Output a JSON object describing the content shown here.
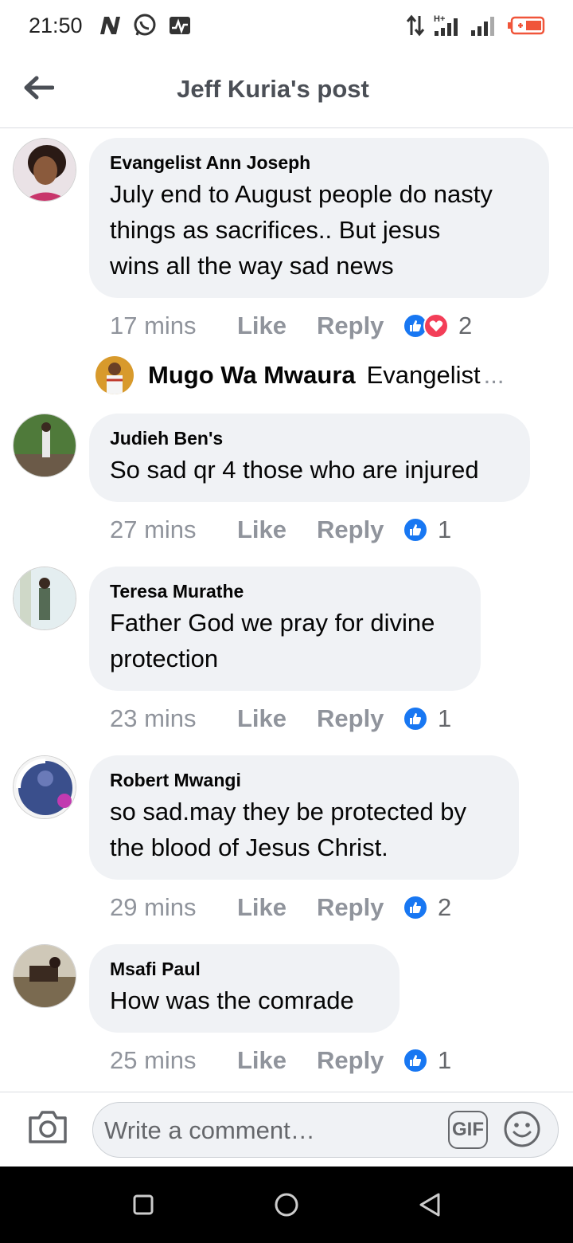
{
  "status_bar": {
    "time": "21:50",
    "icons": [
      "n-app-icon",
      "whatsapp-icon",
      "activity-icon",
      "data-arrows-icon",
      "signal-h-plus-icon",
      "signal-icon",
      "battery-icon"
    ]
  },
  "header": {
    "title": "Jeff Kuria's post",
    "back_icon": "back-arrow-icon"
  },
  "comments": [
    {
      "author": "Evangelist Ann Joseph",
      "text_lines": [
        "July end to August people do nasty",
        "things as sacrifices.. But jesus",
        "wins all the way sad news"
      ],
      "time": "17 mins",
      "like_label": "Like",
      "reply_label": "Reply",
      "reactions": [
        "like",
        "love"
      ],
      "reaction_count": "2"
    },
    {
      "author": "Judieh Ben's",
      "text_lines": [
        "So sad qr 4 those who are injured"
      ],
      "time": "27 mins",
      "like_label": "Like",
      "reply_label": "Reply",
      "reactions": [
        "like"
      ],
      "reaction_count": "1"
    },
    {
      "author": "Teresa Murathe",
      "text_lines": [
        "Father God we pray for divine",
        "protection"
      ],
      "time": "23 mins",
      "like_label": "Like",
      "reply_label": "Reply",
      "reactions": [
        "like"
      ],
      "reaction_count": "1"
    },
    {
      "author": "Robert Mwangi",
      "text_lines": [
        "so sad.may they be protected by",
        "the blood of Jesus Christ."
      ],
      "time": "29 mins",
      "like_label": "Like",
      "reply_label": "Reply",
      "reactions": [
        "like"
      ],
      "reaction_count": "2"
    },
    {
      "author": "Msafi Paul",
      "text_lines": [
        "How was the comrade"
      ],
      "time": "25 mins",
      "like_label": "Like",
      "reply_label": "Reply",
      "reactions": [
        "like"
      ],
      "reaction_count": "1"
    }
  ],
  "reply_preview": {
    "author": "Mugo Wa Mwaura",
    "snippet": "Evangelist",
    "ellipsis": "..."
  },
  "composer": {
    "placeholder": "Write a comment…",
    "gif_label": "GIF",
    "camera_icon": "camera-icon",
    "emoji_icon": "emoji-icon"
  },
  "colors": {
    "accent_blue": "#1877f2",
    "love_red": "#f33e58",
    "bubble_bg": "#f0f2f5",
    "meta_gray": "#90949c"
  }
}
